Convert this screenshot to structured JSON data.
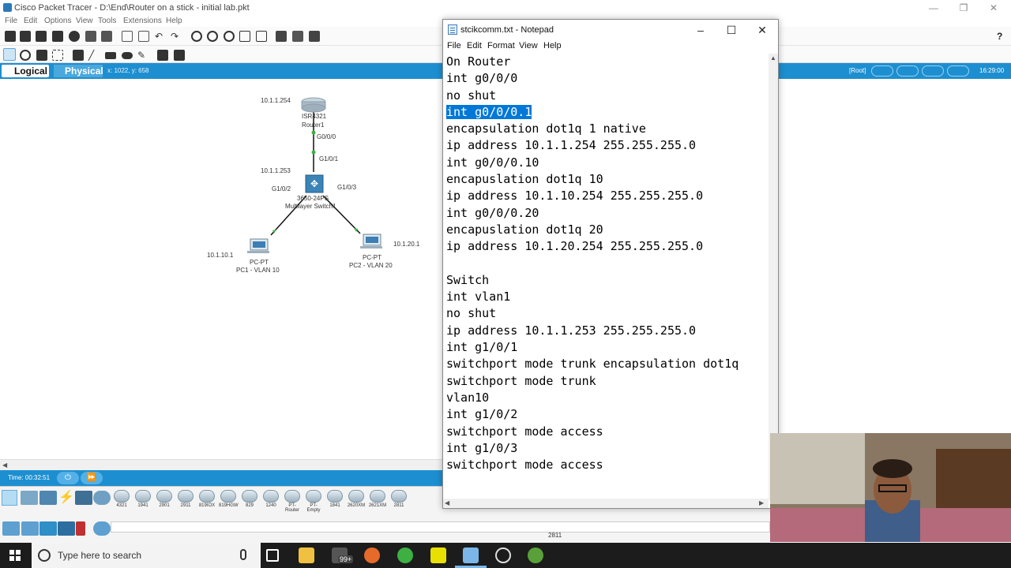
{
  "packet_tracer": {
    "title": "Cisco Packet Tracer - D:\\End\\Router on a stick - initial lab.pkt",
    "menu": [
      "File",
      "Edit",
      "Options",
      "View",
      "Tools",
      "Extensions",
      "Help"
    ],
    "help_icon": "?",
    "mode_logical": "Logical",
    "mode_physical": "Physical",
    "coords": "x: 1022, y: 658",
    "root_label": "[Root]",
    "clock": "16:29:00",
    "sim_time": "Time: 00:32:51",
    "devices": {
      "router": {
        "model": "ISR4321",
        "name": "Router1",
        "ip": "10.1.1.254"
      },
      "switch": {
        "model": "3650-24PS",
        "name": "Multilayer Switch1",
        "ip": "10.1.1.253"
      },
      "pc1": {
        "type": "PC-PT",
        "name": "PC1 - VLAN 10",
        "ip": "10.1.10.1"
      },
      "pc2": {
        "type": "PC-PT",
        "name": "PC2 - VLAN 20",
        "ip": "10.1.20.1"
      }
    },
    "ports": {
      "router_g000": "G0/0/0",
      "switch_g101": "G1/0/1",
      "switch_g102": "G1/0/2",
      "switch_g103": "G1/0/3"
    },
    "device_models": [
      "4321",
      "1941",
      "2901",
      "2911",
      "819IOX",
      "819HGW",
      "829",
      "1240",
      "PT-Router",
      "PT-Empty",
      "1841",
      "2620XM",
      "2621XM",
      "2811"
    ],
    "current_device": "2811"
  },
  "notepad": {
    "title": "stcikcomm.txt - Notepad",
    "menu": [
      "File",
      "Edit",
      "Format",
      "View",
      "Help"
    ],
    "lines": [
      "On Router",
      "int g0/0/0",
      "no shut",
      "int g0/0/0.1",
      "encapsulation dot1q 1 native",
      "ip address 10.1.1.254 255.255.255.0",
      "int g0/0/0.10",
      "encapuslation dot1q 10",
      "ip address 10.1.10.254 255.255.255.0",
      "int g0/0/0.20",
      "encapuslation dot1q 20",
      "ip address 10.1.20.254 255.255.255.0",
      "",
      "Switch",
      "int vlan1",
      "no shut",
      "ip address 10.1.1.253 255.255.255.0",
      "int g1/0/1",
      "switchport mode trunk encapsulation dot1q",
      "switchport mode trunk",
      "vlan10",
      "int g1/0/2",
      "switchport mode access",
      "int g1/0/3",
      "switchport mode access"
    ],
    "selected_line_index": 3
  },
  "taskbar": {
    "search_placeholder": "Type here to search",
    "badge": "99+"
  }
}
